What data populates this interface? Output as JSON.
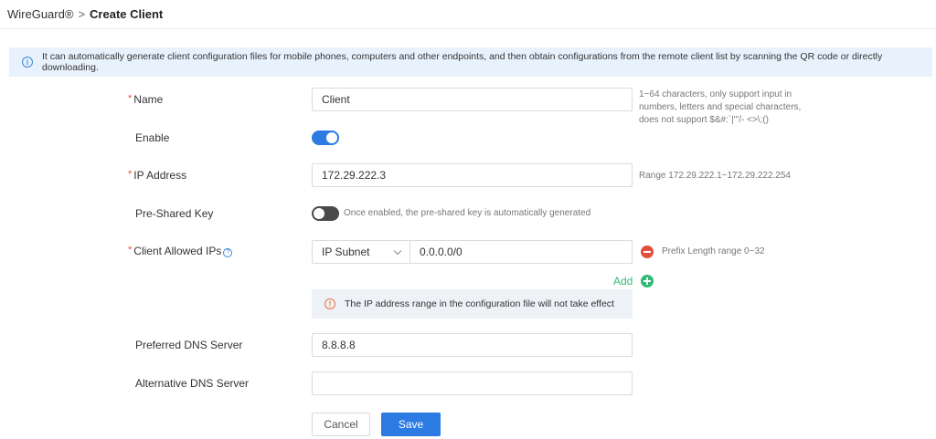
{
  "breadcrumb": {
    "parent": "WireGuard®",
    "separator": ">",
    "current": "Create Client"
  },
  "info_banner": {
    "icon": "info-icon",
    "text": "It can automatically generate client configuration files for mobile phones, computers and other endpoints, and then obtain configurations from the remote client list by scanning the QR code or directly downloading."
  },
  "form": {
    "name": {
      "label": "Name",
      "required": true,
      "value": "Client",
      "hint_lines": [
        "1~64 characters, only support input in",
        "numbers, letters and special characters,",
        "does not support $&#:`|\"'/- <>\\;()"
      ]
    },
    "enable": {
      "label": "Enable",
      "on": true
    },
    "ip_address": {
      "label": "IP Address",
      "required": true,
      "value": "172.29.222.3",
      "hint": "Range 172.29.222.1~172.29.222.254"
    },
    "pre_shared_key": {
      "label": "Pre-Shared Key",
      "on": false,
      "hint": "Once enabled, the pre-shared key is automatically generated"
    },
    "client_allowed_ips": {
      "label": "Client Allowed IPs",
      "required": true,
      "help_icon": "question-icon",
      "type_value": "IP Subnet",
      "value": "0.0.0.0/0",
      "hint": "Prefix Length range 0~32",
      "add_label": "Add",
      "warning": "The IP address range in the configuration file will not take effect"
    },
    "preferred_dns": {
      "label": "Preferred DNS Server",
      "value": "8.8.8.8"
    },
    "alternative_dns": {
      "label": "Alternative DNS Server",
      "value": ""
    }
  },
  "buttons": {
    "cancel": "Cancel",
    "save": "Save"
  },
  "colors": {
    "primary": "#2b7be3",
    "add_green": "#2ebc76",
    "remove_red": "#e34f3d",
    "required_red": "#e2533d",
    "info_banner_bg": "#e8f2fd",
    "warning_orange": "#e8743b"
  }
}
